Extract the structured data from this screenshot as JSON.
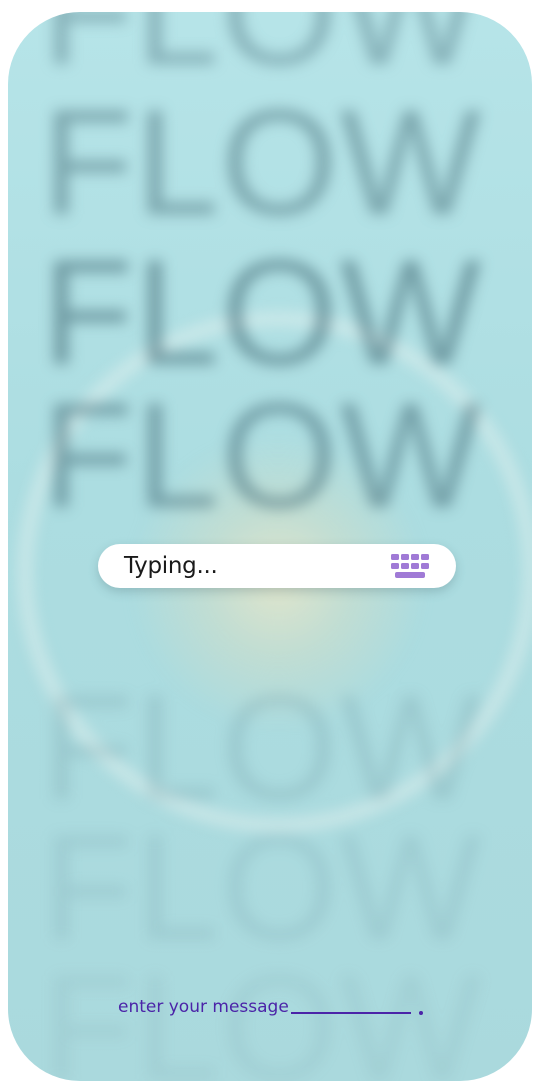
{
  "background": {
    "words": [
      "FLOW",
      "FLOW",
      "FLOW",
      "FLOW",
      "FLOW",
      "FLOW",
      "FLOW"
    ],
    "colors": {
      "surface": "#b6e4e8",
      "text_tint": "#466e78",
      "glow": "#e8e6c8"
    }
  },
  "status_bar": {
    "text": "Typing...",
    "icon": "keyboard-icon",
    "icon_color": "#a07ad6"
  },
  "message_prompt": {
    "text": "enter your message",
    "color": "#4b24a8"
  }
}
